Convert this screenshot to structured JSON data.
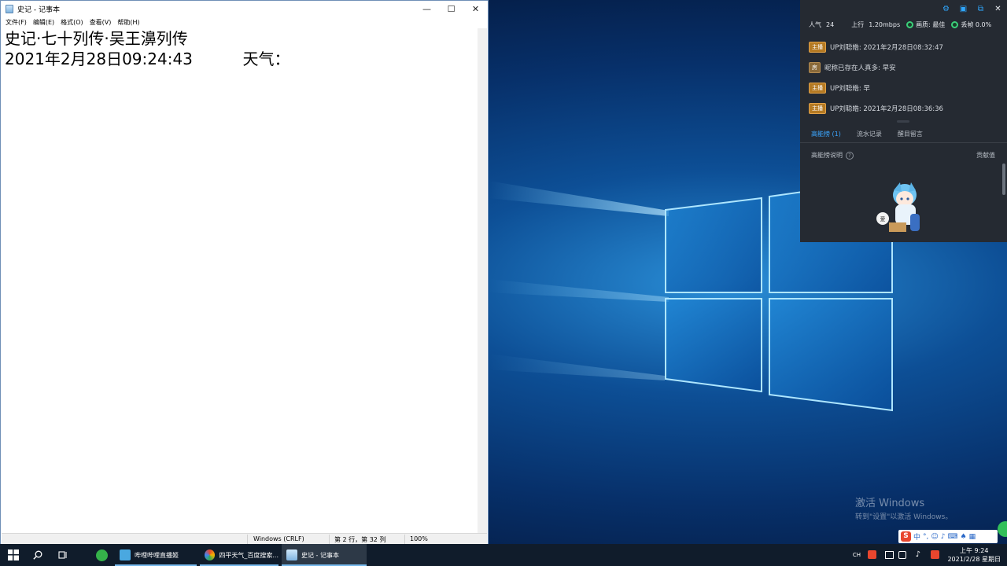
{
  "notepad": {
    "title": "史记 - 记事本",
    "controls": {
      "minimize": "—",
      "maximize": "☐",
      "close": "✕"
    },
    "menu": [
      "文件(F)",
      "编辑(E)",
      "格式(O)",
      "查看(V)",
      "帮助(H)"
    ],
    "lines": [
      "史记·七十列传·吴王濞列传",
      "2021年2月28日09:24:43          天气："
    ],
    "status": {
      "encoding": "Windows (CRLF)",
      "position": "第 2 行，第 32 列",
      "zoom": "100%"
    }
  },
  "danmaku": {
    "stats": {
      "popularity_label": "人气",
      "popularity_value": "24",
      "upload_label": "上行",
      "upload_value": "1.20mbps",
      "quality_label": "画质: 最佳",
      "frame_loss_label": "丢帧 0.0%"
    },
    "messages": [
      {
        "badge": "主播",
        "badge_type": "host",
        "text": "UP刘聪皓: 2021年2月28日08:32:47"
      },
      {
        "badge": "房",
        "badge_type": "room",
        "text": "昵称已存在人真多: 早安"
      },
      {
        "badge": "主播",
        "badge_type": "host",
        "text": "UP刘聪皓: 早"
      },
      {
        "badge": "主播",
        "badge_type": "host",
        "text": "UP刘聪皓: 2021年2月28日08:36:36"
      }
    ],
    "tabs": [
      {
        "label": "高能榜 (1)",
        "active": true
      },
      {
        "label": "流水记录",
        "active": false
      },
      {
        "label": "醒目留言",
        "active": false
      }
    ],
    "list_header_left": "高能榜说明",
    "list_header_right": "贡献值",
    "mascot_bubble": "爱"
  },
  "watermark": {
    "title": "激活 Windows",
    "subtitle": "转到\"设置\"以激活 Windows。"
  },
  "ime": {
    "logo": "S",
    "mode": "中",
    "punct": "°,",
    "icons": [
      "emoji-icon",
      "mic-icon",
      "keyboard-icon",
      "shirt-icon",
      "grid-icon"
    ]
  },
  "taskbar": {
    "apps": [
      {
        "label": "哔哩哔哩直播姬",
        "active": false
      },
      {
        "label": "四平天气_百度搜索...",
        "active": false
      },
      {
        "label": "史记 - 记事本",
        "active": true
      }
    ],
    "tray": {
      "lang": "CH",
      "time": "上午 9:24",
      "date": "2021/2/28 星期日"
    }
  }
}
